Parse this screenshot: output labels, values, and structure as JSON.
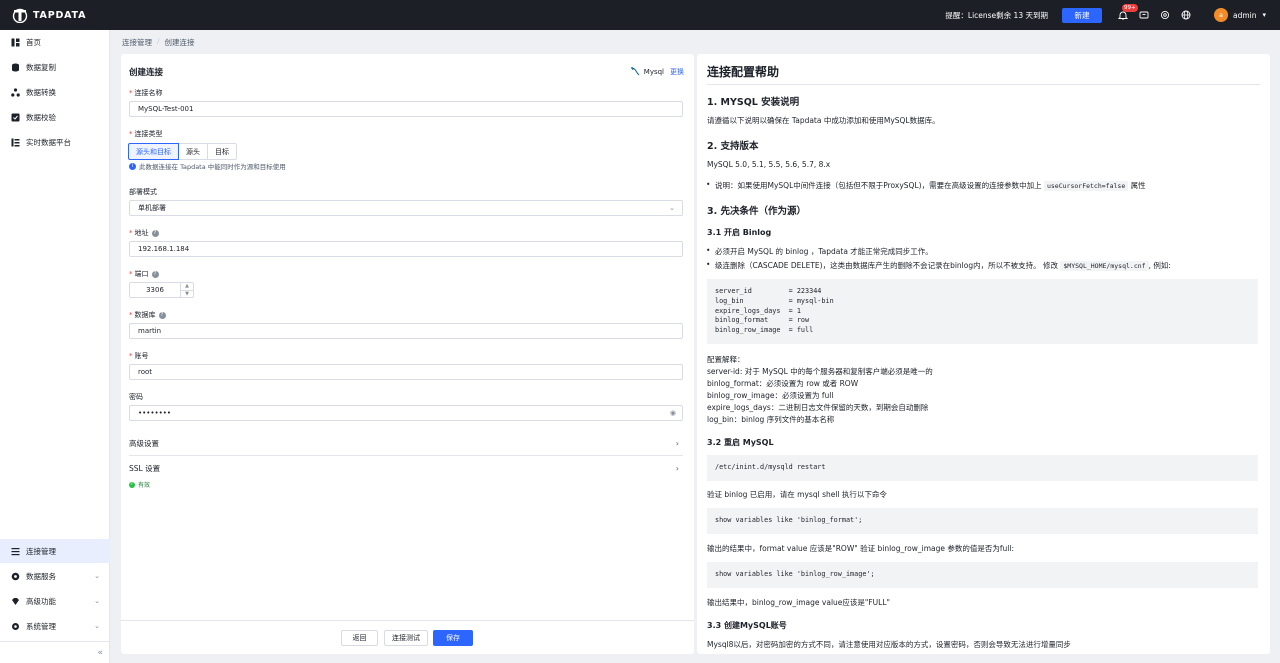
{
  "topbar": {
    "brand": "TAPDATA",
    "notice": "提醒：License剩余 13 天到期",
    "new_button": "新建",
    "notification_badge": "99+",
    "user_initial": "a",
    "username": "admin"
  },
  "sidebar": {
    "items": [
      {
        "label": "首页",
        "icon": "home-icon"
      },
      {
        "label": "数据复制",
        "icon": "database-icon"
      },
      {
        "label": "数据转换",
        "icon": "transform-icon"
      },
      {
        "label": "数据校验",
        "icon": "verify-icon"
      },
      {
        "label": "实时数据平台",
        "icon": "platform-icon"
      }
    ],
    "bottom_items": [
      {
        "label": "连接管理",
        "icon": "list-icon",
        "active": true
      },
      {
        "label": "数据服务",
        "icon": "service-icon"
      },
      {
        "label": "高级功能",
        "icon": "diamond-icon"
      },
      {
        "label": "系统管理",
        "icon": "gear-icon"
      }
    ],
    "collapse_glyph": "«"
  },
  "breadcrumb": {
    "items": [
      "连接管理",
      "创建连接"
    ],
    "separator": "/"
  },
  "form": {
    "title": "创建连接",
    "db_type": "Mysql",
    "change_label": "更换",
    "name_label": "连接名称",
    "name_value": "MySQL-Test-001",
    "type_label": "连接类型",
    "type_options": [
      "源头和目标",
      "源头",
      "目标"
    ],
    "type_hint": "此数据连接在 Tapdata 中能同时作为源和目标使用",
    "deploy_label": "部署模式",
    "deploy_value": "单机部署",
    "host_label": "地址",
    "host_value": "192.168.1.184",
    "port_label": "端口",
    "port_value": "3306",
    "db_label": "数据库",
    "db_value": "martin",
    "user_label": "账号",
    "user_value": "root",
    "pwd_label": "密码",
    "pwd_value": "••••••••",
    "advanced_label": "高级设置",
    "ssl_label": "SSL 设置",
    "valid_label": "有效",
    "back_button": "返回",
    "test_button": "连接测试",
    "save_button": "保存"
  },
  "help": {
    "title": "连接配置帮助",
    "s1": "1. MYSQL 安装说明",
    "s1_p": "请遵循以下说明以确保在 Tapdata 中成功添加和使用MySQL数据库。",
    "s2": "2. 支持版本",
    "s2_p": "MySQL 5.0, 5.1, 5.5, 5.6, 5.7, 8.x",
    "s2_li_a": "说明：如果使用MySQL中间件连接（包括但不限于ProxySQL)，需要在高级设置的连接参数中加上",
    "s2_li_code": "useCursorFetch=false",
    "s2_li_b": "属性",
    "s3": "3. 先决条件（作为源）",
    "s31": "3.1 开启 Binlog",
    "s31_li1": "必须开启 MySQL 的 binlog ，Tapdata 才能正常完成同步工作。",
    "s31_li2_a": "级连删除（CASCADE DELETE)，这类由数据库产生的删除不会记录在binlog内，所以不被支持。 修改",
    "s31_li2_code": "$MYSQL_HOME/mysql.cnf",
    "s31_li2_b": ", 例如:",
    "config_code": "server_id         = 223344\nlog_bin           = mysql-bin\nexpire_logs_days  = 1\nbinlog_format     = row\nbinlog_row_image  = full",
    "explain_title": "配置解释：",
    "explain_lines": [
      "server-id: 对于 MySQL 中的每个服务器和复制客户端必须是唯一的",
      "binlog_format：必须设置为 row 或者 ROW",
      "binlog_row_image：必须设置为 full",
      "expire_logs_days：二进制日志文件保留的天数，到期会自动删除",
      "log_bin：binlog 序列文件的基本名称"
    ],
    "s32": "3.2 重启 MySQL",
    "restart_code": "/etc/inint.d/mysqld restart",
    "verify_p": "验证 binlog 已启用，请在 mysql shell 执行以下命令",
    "show_code1": "show variables like 'binlog_format';",
    "output_p1": "输出的结果中，format value 应该是\"ROW\" 验证 binlog_row_image 参数的值是否为full:",
    "show_code2": "show variables like 'binlog_row_image';",
    "output_p2": "输出结果中，binlog_row_image value应该是\"FULL\"",
    "s33": "3.3 创建MySQL账号",
    "s33_p": "Mysql8以后，对密码加密的方式不同，请注意使用对应版本的方式，设置密码，否则会导致无法进行增量同步"
  }
}
